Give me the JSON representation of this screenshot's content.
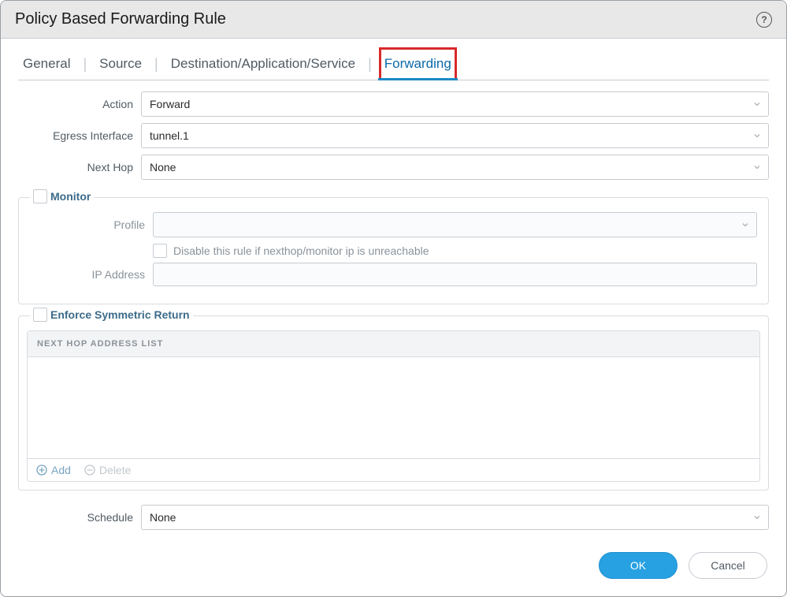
{
  "header": {
    "title": "Policy Based Forwarding Rule",
    "help_icon": "help-icon"
  },
  "tabs": [
    {
      "label": "General",
      "active": false
    },
    {
      "label": "Source",
      "active": false
    },
    {
      "label": "Destination/Application/Service",
      "active": false
    },
    {
      "label": "Forwarding",
      "active": true,
      "highlighted": true
    }
  ],
  "fields": {
    "action": {
      "label": "Action",
      "value": "Forward"
    },
    "egress_interface": {
      "label": "Egress Interface",
      "value": "tunnel.1"
    },
    "next_hop": {
      "label": "Next Hop",
      "value": "None"
    },
    "schedule": {
      "label": "Schedule",
      "value": "None"
    }
  },
  "monitor": {
    "legend": "Monitor",
    "checked": false,
    "profile": {
      "label": "Profile",
      "value": ""
    },
    "disable_rule": {
      "label": "Disable this rule if nexthop/monitor ip is unreachable",
      "checked": false
    },
    "ip_address": {
      "label": "IP Address",
      "value": ""
    }
  },
  "symmetric": {
    "legend": "Enforce Symmetric Return",
    "checked": false,
    "list_header": "NEXT HOP ADDRESS LIST",
    "rows": [],
    "add_label": "Add",
    "delete_label": "Delete"
  },
  "footer": {
    "ok": "OK",
    "cancel": "Cancel"
  }
}
